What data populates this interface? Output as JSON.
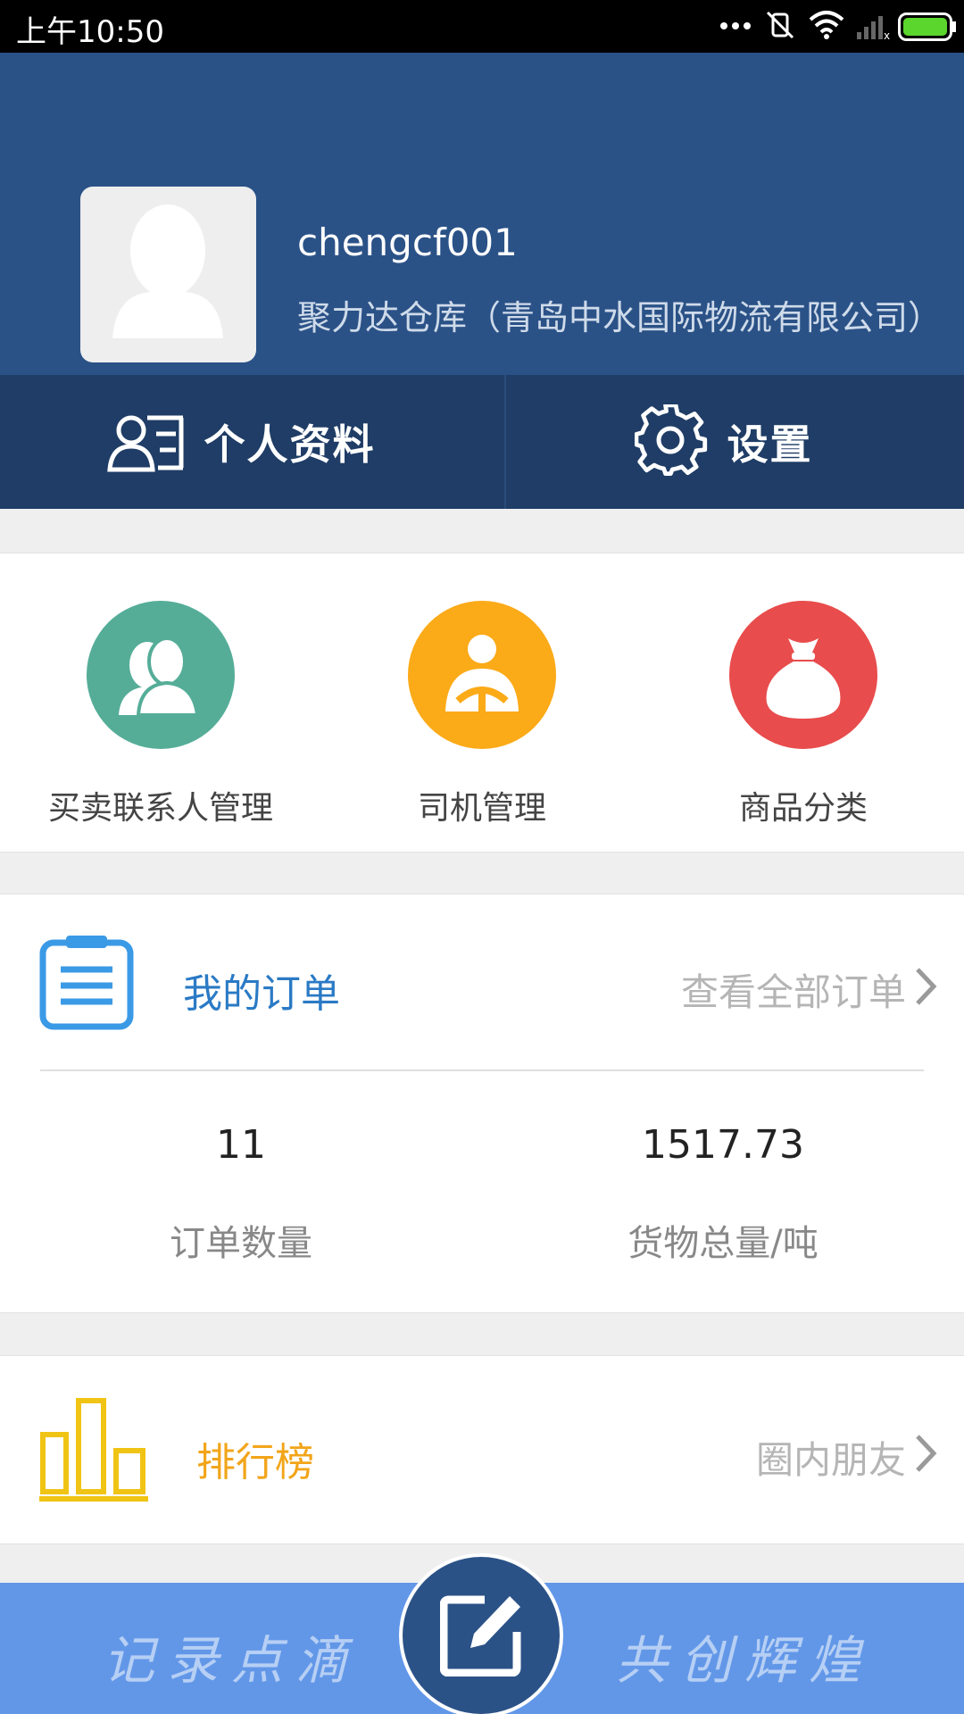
{
  "status_bar": {
    "time": "上午10:50"
  },
  "profile": {
    "username": "chengcf001",
    "company": "聚力达仓库（青岛中水国际物流有限公司）"
  },
  "header_tabs": [
    {
      "label": "个人资料",
      "icon": "profile-card-icon"
    },
    {
      "label": "设置",
      "icon": "gear-icon"
    }
  ],
  "quick_actions": [
    {
      "label": "买卖联系人管理",
      "icon": "contacts-icon",
      "color": "#55ad98"
    },
    {
      "label": "司机管理",
      "icon": "driver-icon",
      "color": "#fbaa18"
    },
    {
      "label": "商品分类",
      "icon": "money-bag-icon",
      "color": "#e84c4c"
    }
  ],
  "orders": {
    "title": "我的订单",
    "link": "查看全部订单",
    "stats": [
      {
        "value": "11",
        "label": "订单数量"
      },
      {
        "value": "1517.73",
        "label": "货物总量/吨"
      }
    ]
  },
  "ranking": {
    "title": "排行榜",
    "link": "圈内朋友"
  },
  "bottom": {
    "left_slogan": "记录点滴",
    "right_slogan": "共创辉煌"
  },
  "colors": {
    "header_bg": "#2b5287",
    "tabs_bg": "#1f3d66",
    "accent_blue": "#2a7ac5",
    "accent_orange": "#f2a51a",
    "bottom_bar": "#6297e8"
  }
}
